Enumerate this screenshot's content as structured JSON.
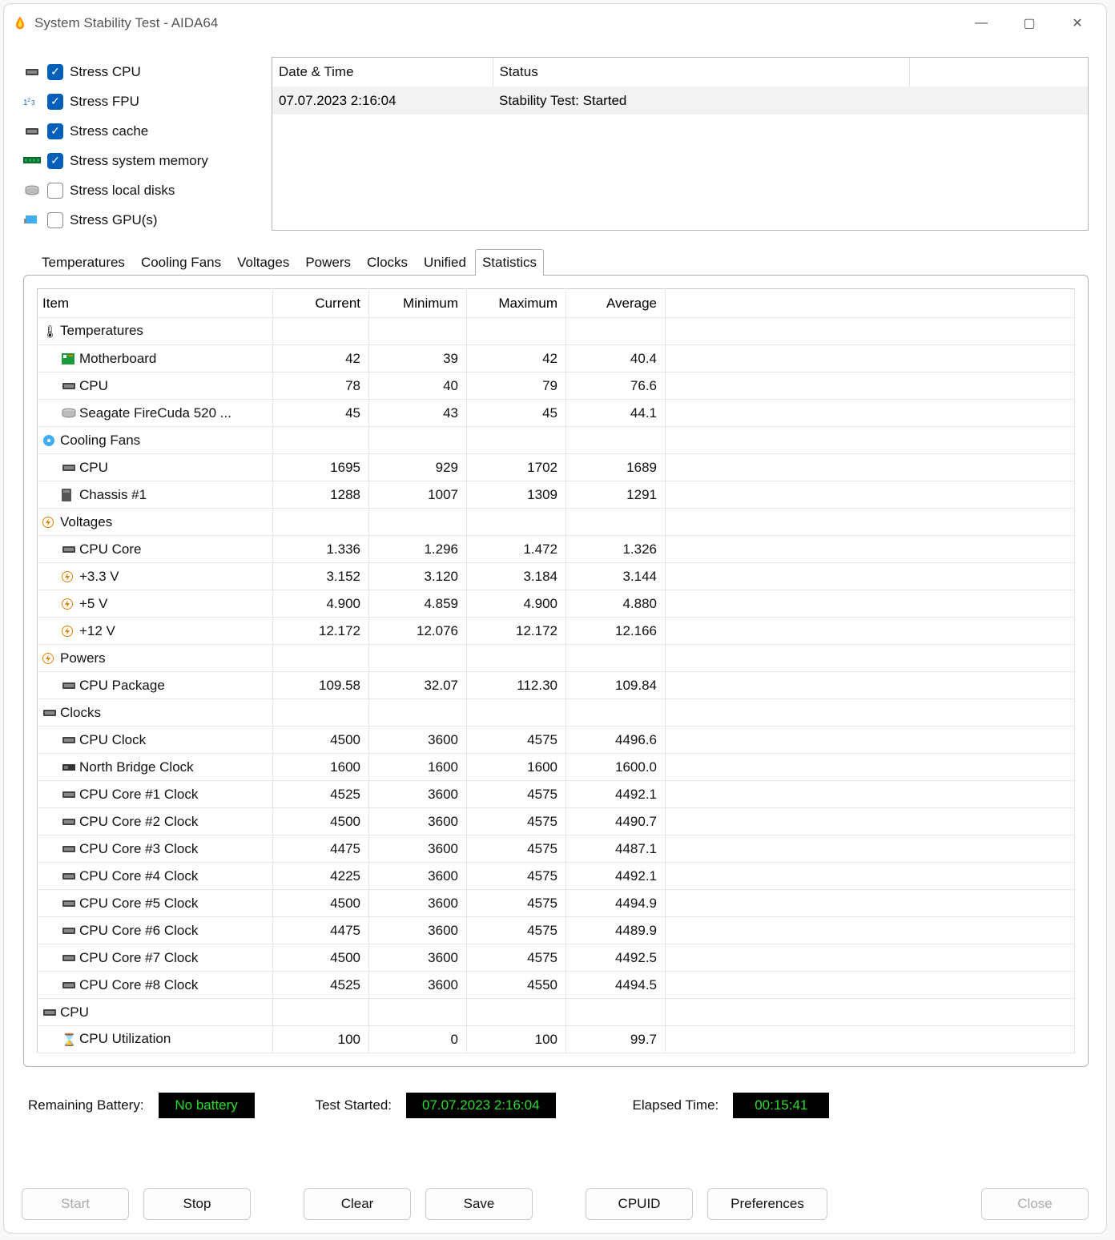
{
  "window": {
    "title": "System Stability Test - AIDA64"
  },
  "stress": [
    {
      "label": "Stress CPU",
      "checked": true,
      "icon": "cpu"
    },
    {
      "label": "Stress FPU",
      "checked": true,
      "icon": "fpu"
    },
    {
      "label": "Stress cache",
      "checked": true,
      "icon": "cache"
    },
    {
      "label": "Stress system memory",
      "checked": true,
      "icon": "ram"
    },
    {
      "label": "Stress local disks",
      "checked": false,
      "icon": "disk"
    },
    {
      "label": "Stress GPU(s)",
      "checked": false,
      "icon": "gpu"
    }
  ],
  "log": {
    "columns": {
      "datetime": "Date & Time",
      "status": "Status"
    },
    "rows": [
      {
        "datetime": "07.07.2023 2:16:04",
        "status": "Stability Test: Started"
      }
    ]
  },
  "tabs": [
    "Temperatures",
    "Cooling Fans",
    "Voltages",
    "Powers",
    "Clocks",
    "Unified",
    "Statistics"
  ],
  "active_tab": "Statistics",
  "stats": {
    "columns": {
      "item": "Item",
      "current": "Current",
      "minimum": "Minimum",
      "maximum": "Maximum",
      "average": "Average"
    },
    "rows": [
      {
        "type": "group",
        "icon": "🌡",
        "label": "Temperatures"
      },
      {
        "type": "data",
        "icon": "mb",
        "label": "Motherboard",
        "current": "42",
        "minimum": "39",
        "maximum": "42",
        "average": "40.4"
      },
      {
        "type": "data",
        "icon": "chip",
        "label": "CPU",
        "current": "78",
        "minimum": "40",
        "maximum": "79",
        "average": "76.6"
      },
      {
        "type": "data",
        "icon": "ssd",
        "label": "Seagate FireCuda 520 ...",
        "current": "45",
        "minimum": "43",
        "maximum": "45",
        "average": "44.1"
      },
      {
        "type": "group",
        "icon": "fan",
        "label": "Cooling Fans"
      },
      {
        "type": "data",
        "icon": "chip",
        "label": "CPU",
        "current": "1695",
        "minimum": "929",
        "maximum": "1702",
        "average": "1689"
      },
      {
        "type": "data",
        "icon": "case",
        "label": "Chassis #1",
        "current": "1288",
        "minimum": "1007",
        "maximum": "1309",
        "average": "1291"
      },
      {
        "type": "group",
        "icon": "bolt",
        "label": "Voltages"
      },
      {
        "type": "data",
        "icon": "chip",
        "label": "CPU Core",
        "current": "1.336",
        "minimum": "1.296",
        "maximum": "1.472",
        "average": "1.326"
      },
      {
        "type": "data",
        "icon": "bolt",
        "label": "+3.3 V",
        "current": "3.152",
        "minimum": "3.120",
        "maximum": "3.184",
        "average": "3.144"
      },
      {
        "type": "data",
        "icon": "bolt",
        "label": "+5 V",
        "current": "4.900",
        "minimum": "4.859",
        "maximum": "4.900",
        "average": "4.880"
      },
      {
        "type": "data",
        "icon": "bolt",
        "label": "+12 V",
        "current": "12.172",
        "minimum": "12.076",
        "maximum": "12.172",
        "average": "12.166"
      },
      {
        "type": "group",
        "icon": "bolt",
        "label": "Powers"
      },
      {
        "type": "data",
        "icon": "chip",
        "label": "CPU Package",
        "current": "109.58",
        "minimum": "32.07",
        "maximum": "112.30",
        "average": "109.84"
      },
      {
        "type": "group",
        "icon": "chip",
        "label": "Clocks"
      },
      {
        "type": "data",
        "icon": "chip",
        "label": "CPU Clock",
        "current": "4500",
        "minimum": "3600",
        "maximum": "4575",
        "average": "4496.6"
      },
      {
        "type": "data",
        "icon": "nb",
        "label": "North Bridge Clock",
        "current": "1600",
        "minimum": "1600",
        "maximum": "1600",
        "average": "1600.0"
      },
      {
        "type": "data",
        "icon": "chip",
        "label": "CPU Core #1 Clock",
        "current": "4525",
        "minimum": "3600",
        "maximum": "4575",
        "average": "4492.1"
      },
      {
        "type": "data",
        "icon": "chip",
        "label": "CPU Core #2 Clock",
        "current": "4500",
        "minimum": "3600",
        "maximum": "4575",
        "average": "4490.7"
      },
      {
        "type": "data",
        "icon": "chip",
        "label": "CPU Core #3 Clock",
        "current": "4475",
        "minimum": "3600",
        "maximum": "4575",
        "average": "4487.1"
      },
      {
        "type": "data",
        "icon": "chip",
        "label": "CPU Core #4 Clock",
        "current": "4225",
        "minimum": "3600",
        "maximum": "4575",
        "average": "4492.1"
      },
      {
        "type": "data",
        "icon": "chip",
        "label": "CPU Core #5 Clock",
        "current": "4500",
        "minimum": "3600",
        "maximum": "4575",
        "average": "4494.9"
      },
      {
        "type": "data",
        "icon": "chip",
        "label": "CPU Core #6 Clock",
        "current": "4475",
        "minimum": "3600",
        "maximum": "4575",
        "average": "4489.9"
      },
      {
        "type": "data",
        "icon": "chip",
        "label": "CPU Core #7 Clock",
        "current": "4500",
        "minimum": "3600",
        "maximum": "4575",
        "average": "4492.5"
      },
      {
        "type": "data",
        "icon": "chip",
        "label": "CPU Core #8 Clock",
        "current": "4525",
        "minimum": "3600",
        "maximum": "4550",
        "average": "4494.5"
      },
      {
        "type": "group",
        "icon": "chip",
        "label": "CPU"
      },
      {
        "type": "data",
        "icon": "hourglass",
        "label": "CPU Utilization",
        "current": "100",
        "minimum": "0",
        "maximum": "100",
        "average": "99.7"
      }
    ]
  },
  "footer": {
    "battery_label": "Remaining Battery:",
    "battery_value": "No battery",
    "started_label": "Test Started:",
    "started_value": "07.07.2023 2:16:04",
    "elapsed_label": "Elapsed Time:",
    "elapsed_value": "00:15:41"
  },
  "buttons": {
    "start": "Start",
    "stop": "Stop",
    "clear": "Clear",
    "save": "Save",
    "cpuid": "CPUID",
    "prefs": "Preferences",
    "close": "Close"
  }
}
